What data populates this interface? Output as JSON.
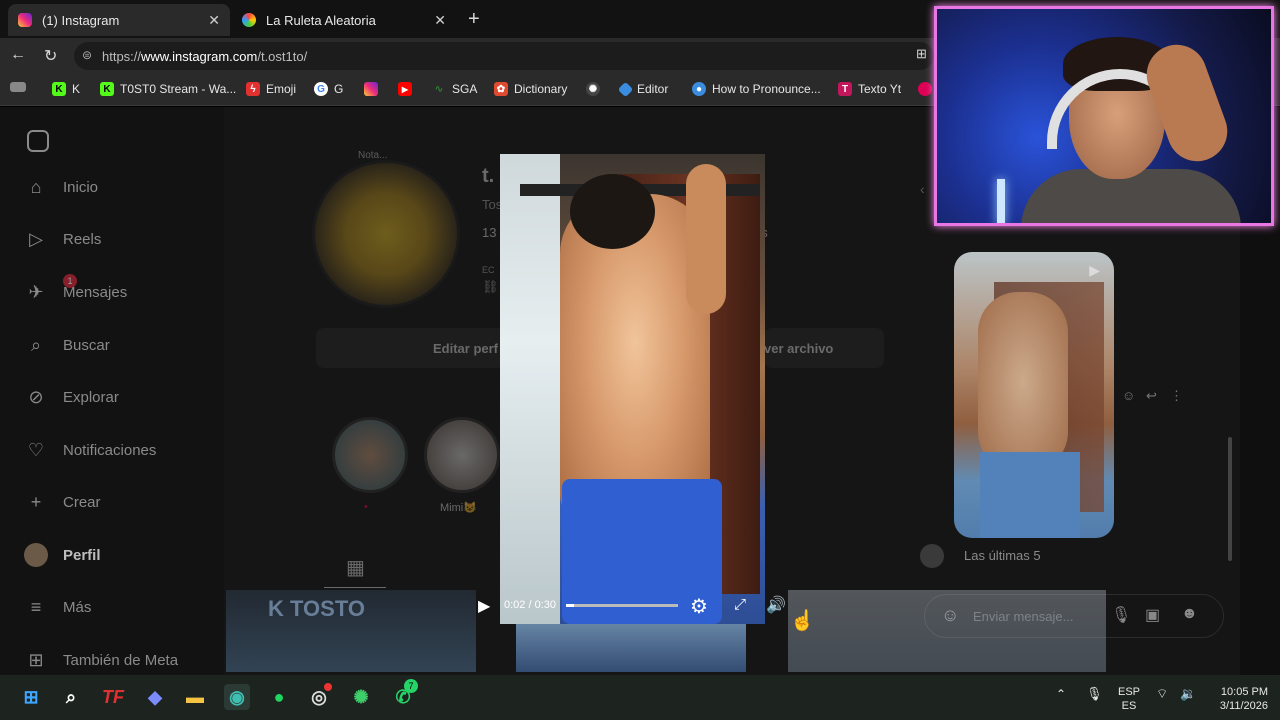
{
  "browser": {
    "tabs": [
      {
        "label": "(1) Instagram",
        "active": true
      },
      {
        "label": "La Ruleta Aleatoria",
        "active": false
      }
    ],
    "url_prefix": "https://",
    "url_host": "www.instagram.com",
    "url_path": "/t.ost1to/",
    "bookmarks": [
      {
        "label": "K",
        "color": "#53fc18"
      },
      {
        "label": "T0ST0 Stream - Wa...",
        "color": "#53fc18"
      },
      {
        "label": "Emoji",
        "color": "#e03030"
      },
      {
        "label": "G",
        "color": "#4285f4"
      },
      {
        "label": "",
        "color": "#d6249f"
      },
      {
        "label": "",
        "color": "#ff0000"
      },
      {
        "label": "SGA",
        "color": "#2e7d32"
      },
      {
        "label": "Dictionary",
        "color": "#e04a2f"
      },
      {
        "label": "",
        "color": "#bbbbbb"
      },
      {
        "label": "Editor",
        "color": "#3a8dde"
      },
      {
        "label": "How to Pronounce...",
        "color": "#3a8dde"
      },
      {
        "label": "Texto Yt",
        "color": "#c2185b"
      }
    ]
  },
  "sidebar": {
    "items": [
      {
        "label": "Inicio",
        "icon": "home-icon"
      },
      {
        "label": "Reels",
        "icon": "reels-icon"
      },
      {
        "label": "Mensajes",
        "icon": "messages-icon",
        "badge": "1"
      },
      {
        "label": "Buscar",
        "icon": "search-icon"
      },
      {
        "label": "Explorar",
        "icon": "compass-icon"
      },
      {
        "label": "Notificaciones",
        "icon": "heart-icon"
      },
      {
        "label": "Crear",
        "icon": "plus-icon"
      },
      {
        "label": "Perfil",
        "icon": "avatar-icon"
      },
      {
        "label": "Más",
        "icon": "menu-icon"
      },
      {
        "label": "También de Meta",
        "icon": "meta-icon"
      }
    ]
  },
  "profile": {
    "note": "Nota...",
    "username_partial": "t.",
    "name_partial": "Tos",
    "count_partial": "13",
    "bio_partial": "EC",
    "count_suffix": "os",
    "edit_button": "Editar perf",
    "archive_button": "ver archivo",
    "highlight_label": "Mimi😺"
  },
  "video": {
    "time": "0:02 / 0:30",
    "progress": 0.067
  },
  "chat": {
    "label": "Las últimas 5",
    "placeholder": "Enviar mensaje..."
  },
  "taskbar": {
    "lang_top": "ESP",
    "lang_bottom": "ES",
    "time": "10:05 PM",
    "date": "3/11/2026",
    "whatsapp_badge": "7"
  }
}
